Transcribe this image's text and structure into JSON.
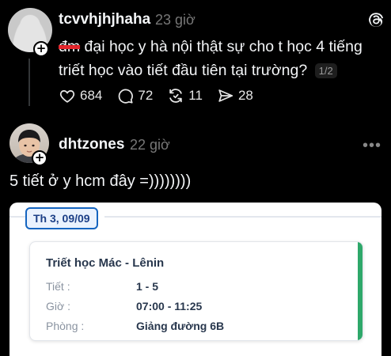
{
  "post1": {
    "username": "tcvvhjhjhaha",
    "time": "23 giờ",
    "redacted_word": "đm",
    "text": " đại học y hà nội thật sự cho t học 4 tiếng triết học vào tiết đầu tiên tại trường?",
    "pager": "1/2",
    "stats": {
      "likes": "684",
      "comments": "72",
      "reposts": "11",
      "shares": "28"
    }
  },
  "post2": {
    "username": "dhtzones",
    "time": "22 giờ",
    "more": "•••",
    "text": "5 tiết ở y hcm đây =))))))))"
  },
  "schedule": {
    "date": "Th 3, 09/09",
    "subject": "Triết học Mác - Lênin",
    "rows": [
      {
        "label": "Tiết :",
        "value": "1 - 5"
      },
      {
        "label": "Giờ :",
        "value": "07:00 - 11:25"
      },
      {
        "label": "Phòng :",
        "value": "Giảng đường 6B"
      }
    ]
  },
  "icons": {
    "avatar_placeholder": "default-avatar-icon",
    "follow": "plus-icon",
    "app": "threads-logo-icon",
    "like": "heart-icon",
    "comment": "comment-bubble-icon",
    "repost": "repost-icon",
    "share": "send-icon"
  },
  "colors": {
    "background": "#000000",
    "text": "#f3f5f7",
    "muted": "#777777",
    "card_accent": "#1565c0",
    "lesson_bar": "#2ea86a",
    "redaction": "#e3262c"
  }
}
